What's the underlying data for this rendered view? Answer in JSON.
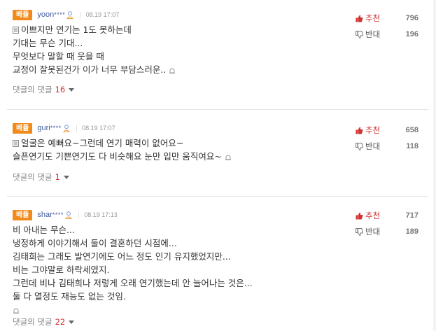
{
  "comments": [
    {
      "badge": "베플",
      "nick": "yoon",
      "masked": "****",
      "date": "08.19 17:07",
      "lines": [
        "이쁘지만 연기는 1도 못하는데",
        "기대는 무슨 기대...",
        "무엇보다 말할 때 웃을 때",
        "교정이 잘못된건가 이가 너무 부담스러운.."
      ],
      "replies_label": "댓글의 댓글",
      "replies_count": "16",
      "up_label": "추천",
      "up_count": "796",
      "down_label": "반대",
      "down_count": "196"
    },
    {
      "badge": "베플",
      "nick": "guri",
      "masked": "****",
      "date": "08.19 17:07",
      "lines": [
        "얼굴은 예뻐요~그런데 연기 매력이 없어요~",
        "슬픈연기도 기쁜연기도 다 비슷해요 눈만 입만 움직여요~"
      ],
      "replies_label": "댓글의 댓글",
      "replies_count": "1",
      "up_label": "추천",
      "up_count": "658",
      "down_label": "반대",
      "down_count": "118"
    },
    {
      "badge": "베플",
      "nick": "shar",
      "masked": "****",
      "date": "08.19 17:13",
      "lines": [
        "비 아내는 무슨...",
        "냉정하게 이야기해서 둘이 결혼하던 시점에...",
        "김태희는 그래도 발연기에도 어느 정도 인기 유지했었지만...",
        "비는 그야말로 하락세였지.",
        "그런데 비나 김태희나 저렇게 오래 연기했는데 안 늘어나는 것은...",
        "둘 다 열정도 재능도 없는 것임."
      ],
      "replies_label": "댓글의 댓글",
      "replies_count": "22",
      "up_label": "추천",
      "up_count": "717",
      "down_label": "반대",
      "down_count": "189"
    }
  ],
  "colors": {
    "badge": "#f08a1b",
    "up": "#d13232",
    "nick": "#3e5a9e"
  }
}
